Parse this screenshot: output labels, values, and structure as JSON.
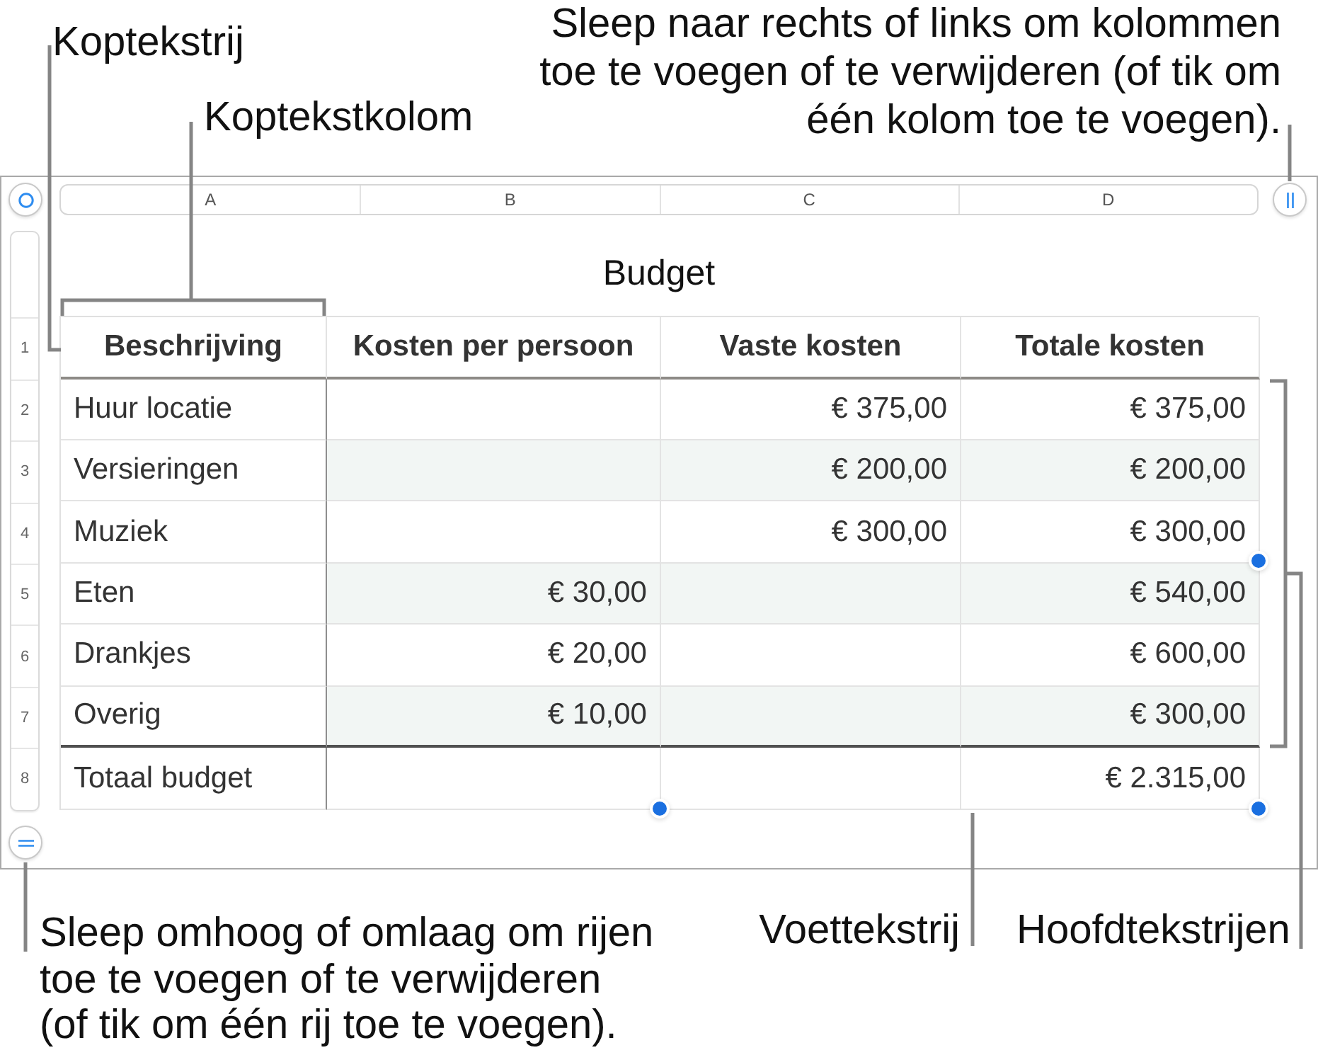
{
  "callouts_top": {
    "header_row": "Koptekstrij",
    "header_column": "Koptekstkolom",
    "add_columns": "Sleep naar rechts of links om kolommen\ntoe te voegen of te verwijderen (of tik om\néén kolom toe te voegen)."
  },
  "sheet": {
    "selected": true,
    "column_labels": [
      "A",
      "B",
      "C",
      "D"
    ],
    "row_numbers": [
      "1",
      "2",
      "3",
      "4",
      "5",
      "6",
      "7",
      "8"
    ],
    "title": "Budget",
    "header_row": [
      "Beschrijving",
      "Kosten per persoon",
      "Vaste kosten",
      "Totale kosten"
    ],
    "body_rows": [
      {
        "description": "Huur locatie",
        "fixed_cost": "€ 375,00",
        "total_cost": "€ 375,00"
      },
      {
        "description": "Versieringen",
        "fixed_cost": "€ 200,00",
        "total_cost": "€ 200,00"
      },
      {
        "description": "Muziek",
        "fixed_cost": "€ 300,00",
        "total_cost": "€ 300,00"
      },
      {
        "description": "Eten",
        "cost_per_person": "€ 30,00",
        "total_cost": "€ 540,00"
      },
      {
        "description": "Drankjes",
        "cost_per_person": "€ 20,00",
        "total_cost": "€ 600,00"
      },
      {
        "description": "Overig",
        "cost_per_person": "€ 10,00",
        "total_cost": "€ 300,00"
      }
    ],
    "footer_row": {
      "description": "Totaal budget",
      "total_cost": "€ 2.315,00"
    }
  },
  "callouts_bottom": {
    "add_rows": "Sleep omhoog of omlaag om rijen\ntoe te voegen of te verwijderen\n(of tik om één rij toe te voegen).",
    "footer_row": "Voettekstrij",
    "body_rows": "Hoofdtekstrijen"
  }
}
